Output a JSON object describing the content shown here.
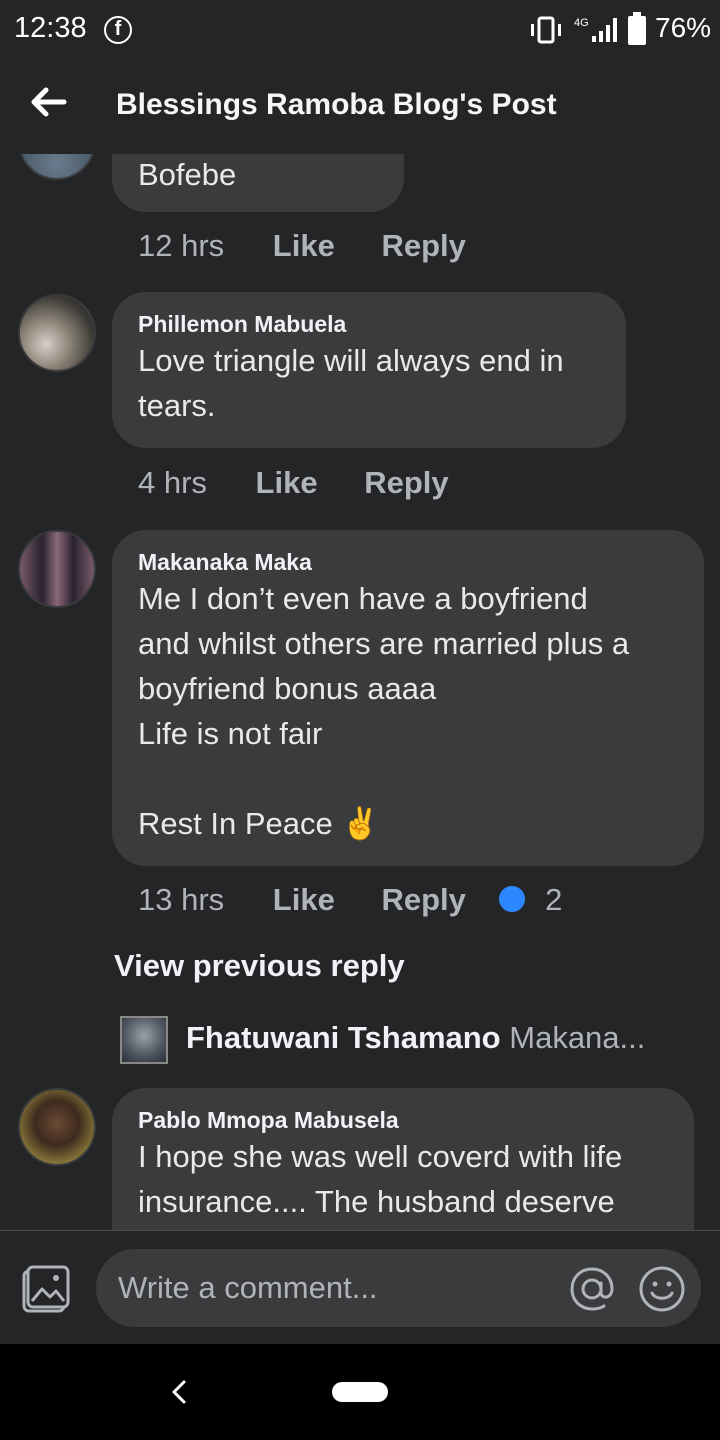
{
  "status_bar": {
    "time": "12:38",
    "network": "4G",
    "battery": "76%"
  },
  "header": {
    "title": "Blessings Ramoba Blog's Post"
  },
  "comments": [
    {
      "author": "",
      "text": "Bofebe",
      "time": "12 hrs",
      "like_label": "Like",
      "reply_label": "Reply"
    },
    {
      "author": "Phillemon Mabuela",
      "text": "Love triangle will always end in\ntears.",
      "time": "4 hrs",
      "like_label": "Like",
      "reply_label": "Reply"
    },
    {
      "author": "Makanaka Maka",
      "text": "Me I don’t even have a boyfriend\nand whilst others are married plus a\nboyfriend bonus aaaa\nLife is not fair\n\nRest In Peace ✌️",
      "time": "13 hrs",
      "like_label": "Like",
      "reply_label": "Reply",
      "reaction_count": "2"
    },
    {
      "author": "Pablo Mmopa Mabusela",
      "text": "I hope she was well coverd with life\ninsurance.... The husband deserve",
      "time": "",
      "like_label": "",
      "reply_label": ""
    }
  ],
  "view_previous_reply": "View previous reply",
  "reply_preview": {
    "author": "Fhatuwani Tshamano",
    "snippet": "Makana..."
  },
  "composer": {
    "placeholder": "Write a comment..."
  },
  "colors": {
    "background": "#242527",
    "bubble": "#3a3b3c",
    "accent": "#2d88ff"
  }
}
